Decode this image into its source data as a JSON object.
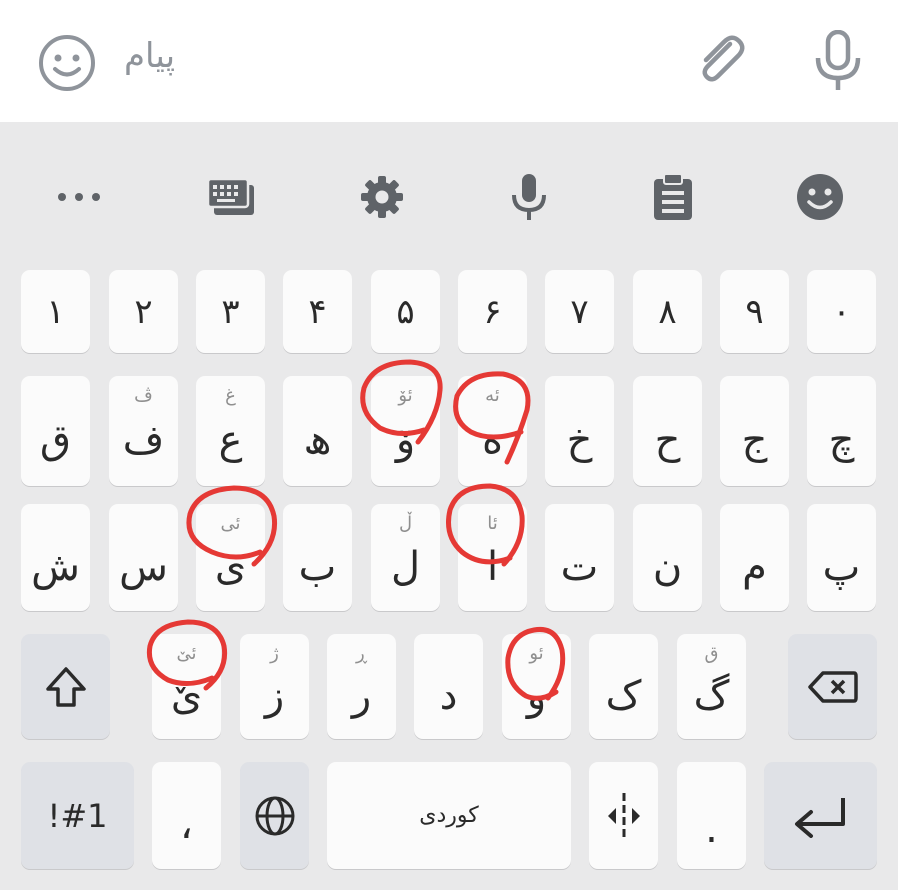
{
  "compose": {
    "placeholder": "پیام",
    "icons": [
      "emoji-icon",
      "attach-icon",
      "mic-icon"
    ]
  },
  "toolbar": {
    "icons": [
      "more-icon",
      "keyboard-switch-icon",
      "settings-icon",
      "voice-input-icon",
      "clipboard-icon",
      "emoji-panel-icon"
    ]
  },
  "rows": {
    "numbers": [
      "١",
      "٢",
      "٣",
      "۴",
      "۵",
      "۶",
      "٧",
      "٨",
      "٩",
      "٠"
    ],
    "row1": [
      {
        "main": "ق",
        "hint": ""
      },
      {
        "main": "ف",
        "hint": "ڤ"
      },
      {
        "main": "ع",
        "hint": "غ"
      },
      {
        "main": "ھ",
        "hint": ""
      },
      {
        "main": "ۆ",
        "hint": "ئۆ"
      },
      {
        "main": "ە",
        "hint": "ئە"
      },
      {
        "main": "خ",
        "hint": ""
      },
      {
        "main": "ح",
        "hint": ""
      },
      {
        "main": "ج",
        "hint": ""
      },
      {
        "main": "چ",
        "hint": ""
      }
    ],
    "row2": [
      {
        "main": "ش",
        "hint": ""
      },
      {
        "main": "س",
        "hint": ""
      },
      {
        "main": "ی",
        "hint": "ئی"
      },
      {
        "main": "ب",
        "hint": ""
      },
      {
        "main": "ل",
        "hint": "ڵ"
      },
      {
        "main": "ا",
        "hint": "ئا"
      },
      {
        "main": "ت",
        "hint": ""
      },
      {
        "main": "ن",
        "hint": ""
      },
      {
        "main": "م",
        "hint": ""
      },
      {
        "main": "پ",
        "hint": ""
      }
    ],
    "row3": [
      {
        "main": "ێ",
        "hint": "ئێ"
      },
      {
        "main": "ز",
        "hint": "ژ"
      },
      {
        "main": "ر",
        "hint": "ڕ"
      },
      {
        "main": "د",
        "hint": ""
      },
      {
        "main": "و",
        "hint": "ئو"
      },
      {
        "main": "ک",
        "hint": ""
      },
      {
        "main": "گ",
        "hint": "ق"
      }
    ],
    "bottom": {
      "symbols": "!#1",
      "comma": "،",
      "space": "کوردی",
      "period": "."
    }
  },
  "colors": {
    "keyboard_bg": "#e9e9ea",
    "key_bg": "#fbfbfb",
    "fn_key_bg": "#dfe1e6",
    "annotation": "#e53935"
  }
}
